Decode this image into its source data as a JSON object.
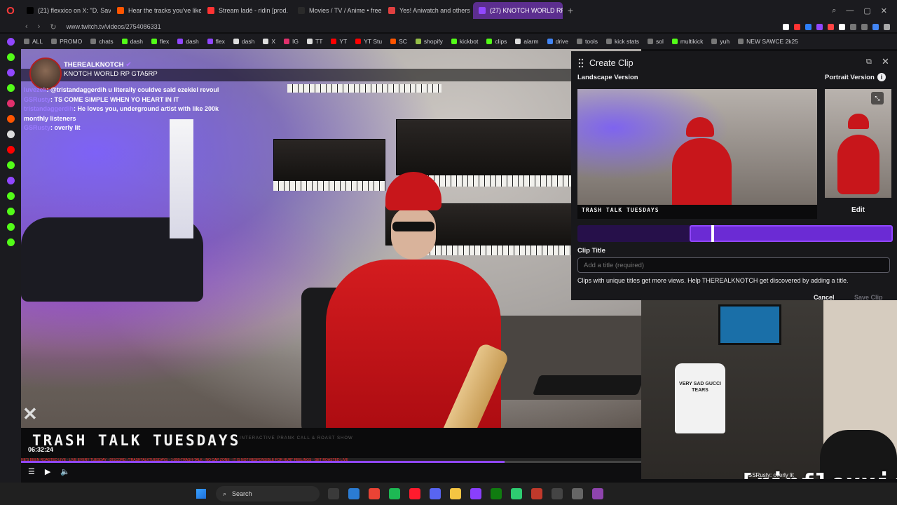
{
  "browser": {
    "tabs": [
      {
        "label": "(21) flexxico on X: \"D. Sava",
        "icon_color": "#000000",
        "active": false
      },
      {
        "label": "Hear the tracks you've liked",
        "icon_color": "#ff5500",
        "active": false
      },
      {
        "label": "Stream ladé - ridin [prod.",
        "icon_color": "#ff3333",
        "active": false
      },
      {
        "label": "Movies / TV / Anime • free",
        "icon_color": "#2a2a2a",
        "active": false
      },
      {
        "label": "Yes! Aniwatch and others",
        "icon_color": "#e04040",
        "active": false
      },
      {
        "label": "(27) KNOTCH WORLD RP",
        "icon_color": "#9147ff",
        "active": true
      }
    ],
    "url": "www.twitch.tv/videos/2754086331",
    "bookmarks": [
      {
        "label": "ALL",
        "color": "#777777"
      },
      {
        "label": "PROMO",
        "color": "#777777"
      },
      {
        "label": "chats",
        "color": "#777777"
      },
      {
        "label": "dash",
        "color": "#53fc18"
      },
      {
        "label": "flex",
        "color": "#53fc18"
      },
      {
        "label": "dash",
        "color": "#9147ff"
      },
      {
        "label": "flex",
        "color": "#9147ff"
      },
      {
        "label": "dash",
        "color": "#dddddd"
      },
      {
        "label": "X",
        "color": "#dddddd"
      },
      {
        "label": "IG",
        "color": "#e1306c"
      },
      {
        "label": "TT",
        "color": "#dddddd"
      },
      {
        "label": "YT",
        "color": "#ff0000"
      },
      {
        "label": "YT Stu",
        "color": "#ff0000"
      },
      {
        "label": "SC",
        "color": "#ff5500"
      },
      {
        "label": "shopify",
        "color": "#95bf47"
      },
      {
        "label": "kickbot",
        "color": "#53fc18"
      },
      {
        "label": "clips",
        "color": "#53fc18"
      },
      {
        "label": "alarm",
        "color": "#dddddd"
      },
      {
        "label": "drive",
        "color": "#4285f4"
      },
      {
        "label": "tools",
        "color": "#777777"
      },
      {
        "label": "kick stats",
        "color": "#777777"
      },
      {
        "label": "sol",
        "color": "#777777"
      },
      {
        "label": "multikick",
        "color": "#53fc18"
      },
      {
        "label": "yuh",
        "color": "#777777"
      },
      {
        "label": "NEW SAWCE 2k25",
        "color": "#777777"
      }
    ]
  },
  "stream": {
    "channel_name": "THEREALKNOTCH",
    "title": "KNOTCH WORLD RP GTA5RP",
    "chat_overlay": [
      {
        "user": "luvezek",
        "text": "@tristandaggerdih u literally couldve said ezekiel revoul"
      },
      {
        "user": "GSRusty",
        "text": "TS COME SIMPLE WHEN YO HEART IN IT"
      },
      {
        "user": "tristandaggerdih",
        "text": "He loves you, underground artist with like 200k monthly listeners"
      },
      {
        "user": "GSRusty",
        "text": "overly lit"
      }
    ],
    "banner_title": "TRASH TALK TUESDAYS",
    "banner_sub": "INTERACTIVE PRANK CALL & ROAST SHOW",
    "ticker_text": "HE'S BEEN ROASTED LIVE · LIVE EVERY TUESDAY · DISCORD: /TRASHTALKTUESDAYS · 1-800-TRASH-TALK · NO CAP ZONE · IT IS NOT RESPONSIBLE FOR HURT FEELINGS · GET ROASTED LIVE",
    "timestamp": "06:32:24",
    "progress_fraction": 0.78
  },
  "clip": {
    "header": "Create Clip",
    "landscape_label": "Landscape Version",
    "portrait_label": "Portrait Version",
    "landscape_caption": "TRASH TALK TUESDAYS",
    "edit_label": "Edit",
    "title_label": "Clip Title",
    "title_placeholder": "Add a title (required)",
    "hint": "Clips with unique titles get more views. Help THEREALKNOTCH get discovered by adding a title.",
    "cancel_label": "Cancel",
    "save_label": "Save Clip"
  },
  "webcam": {
    "shirt_text": "VERY SAD GUCCI TEARS",
    "chat_line": "GSRusty: overly lit",
    "tag": "[ripflexxico]"
  },
  "taskbar": {
    "search_label": "Search",
    "app_colors": [
      "#3a3a3a",
      "#2b7cd3",
      "#ea4335",
      "#1db954",
      "#ff1b2d",
      "#5865f2",
      "#f5c542",
      "#8a3ffc",
      "#107c10",
      "#2ecc71",
      "#c0392b",
      "#444444",
      "#666666",
      "#8e44ad"
    ]
  },
  "sidebar_colors": [
    "#9147ff",
    "#53fc18",
    "#9147ff",
    "#53fc18",
    "#e1306c",
    "#ff5500",
    "#dddddd",
    "#ff0000",
    "#53fc18",
    "#9147ff",
    "#53fc18",
    "#53fc18",
    "#53fc18",
    "#53fc18"
  ],
  "extension_colors": [
    "#ffffff",
    "#ff3333",
    "#2d7ff9",
    "#9147ff",
    "#ff4444",
    "#ffffff",
    "#777777",
    "#777777",
    "#4285f4",
    "#aaaaaa"
  ]
}
